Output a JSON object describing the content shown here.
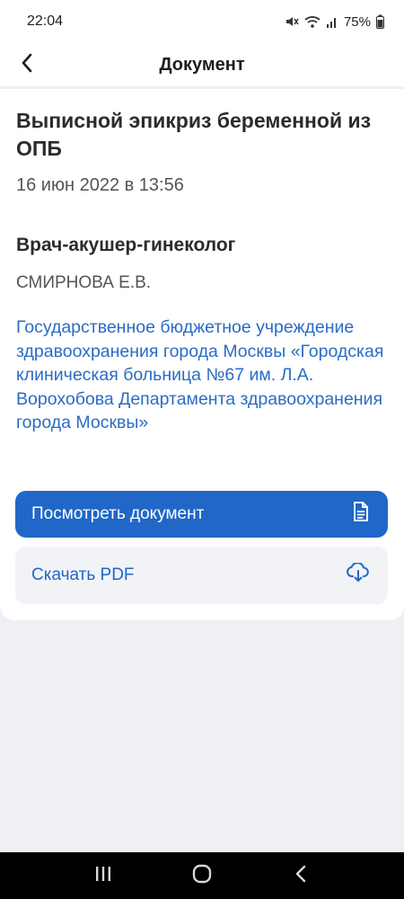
{
  "status_bar": {
    "time": "22:04",
    "battery": "75%",
    "icons": [
      "mute-icon",
      "wifi-icon",
      "signal-icon",
      "battery-icon"
    ]
  },
  "app_bar": {
    "title": "Документ",
    "back_icon": "chevron-left-icon"
  },
  "document": {
    "title": "Выписной эпикриз беременной из ОПБ",
    "date": "16 июн 2022 в 13:56"
  },
  "doctor": {
    "role": "Врач-акушер-гинеколог",
    "name": "СМИРНОВА Е.В."
  },
  "organization": {
    "name": "Государственное бюджетное учреждение здравоохранения города Москвы «Городская клиническая больница №67 им. Л.А. Ворохобова Департамента здравоохранения города Москвы»"
  },
  "actions": {
    "view_label": "Посмотреть документ",
    "view_icon": "document-icon",
    "download_label": "Скачать PDF",
    "download_icon": "cloud-download-icon"
  },
  "nav_bar": {
    "icons": [
      "recent-apps-icon",
      "home-icon",
      "back-icon"
    ]
  },
  "colors": {
    "accent": "#2067c8",
    "link": "#2b6cc4",
    "background": "#eef0f5",
    "secondary_button_bg": "#f1f3f7"
  }
}
